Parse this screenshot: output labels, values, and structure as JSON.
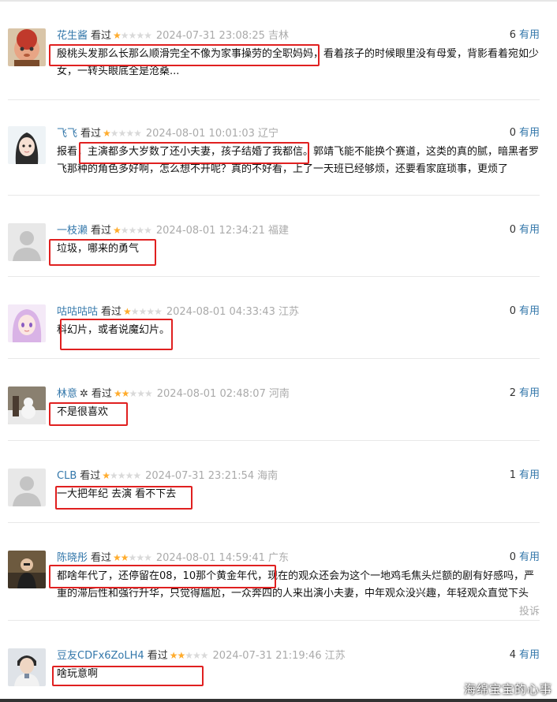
{
  "colors": {
    "link": "#3377aa",
    "star": "#ffac2d",
    "highlight": "#e02020",
    "muted": "#aaaaaa"
  },
  "comments": [
    {
      "user": "花生酱",
      "watched": "看过",
      "rating": 1,
      "time": "2024-07-31 23:08:25",
      "location": "吉林",
      "votes": "6",
      "vote_label": "有用",
      "avatar": "cartoon-avatar",
      "text": "殷桃头发那么长那么顺滑完全不像为家事操劳的全职妈妈，看着孩子的时候眼里没有母爱，背影看着宛如少女，一转头眼底全是沧桑..."
    },
    {
      "user": "飞飞",
      "watched": "看过",
      "rating": 1,
      "time": "2024-08-01 10:01:03",
      "location": "辽宁",
      "votes": "0",
      "vote_label": "有用",
      "avatar": "anime-girl-avatar",
      "text": "报看，主演都多大岁数了还小夫妻，孩子结婚了我都信。郭靖飞能不能换个赛道，这类的真的腻，暗黑者罗飞那种的角色多好啊，怎么想不开呢？真的不好看，上了一天班已经够烦，还要看家庭琐事，更烦了"
    },
    {
      "user": "一枝濑",
      "watched": "看过",
      "rating": 1,
      "time": "2024-08-01 12:34:21",
      "location": "福建",
      "votes": "0",
      "vote_label": "有用",
      "avatar": "default-avatar",
      "text": "垃圾，哪来的勇气"
    },
    {
      "user": "咕咕咕咕",
      "watched": "看过",
      "rating": 1,
      "time": "2024-08-01 04:33:43",
      "location": "江苏",
      "votes": "0",
      "vote_label": "有用",
      "avatar": "anime-pink-avatar",
      "text": "科幻片，或者说魔幻片。"
    },
    {
      "user": "林意",
      "watched": "看过",
      "rating": 2,
      "time": "2024-08-01 02:48:07",
      "location": "河南",
      "votes": "2",
      "vote_label": "有用",
      "avatar": "snowman-photo-avatar",
      "text": "不是很喜欢"
    },
    {
      "user": "CLB",
      "watched": "看过",
      "rating": 1,
      "time": "2024-07-31 23:21:54",
      "location": "海南",
      "votes": "1",
      "vote_label": "有用",
      "avatar": "default-avatar",
      "text": "一大把年纪 去演 看不下去"
    },
    {
      "user": "陈晓彤",
      "watched": "看过",
      "rating": 2,
      "time": "2024-08-01 14:59:41",
      "location": "广东",
      "votes": "0",
      "vote_label": "有用",
      "avatar": "photo-avatar",
      "text": "都啥年代了，还停留在08，10那个黄金年代，现在的观众还会为这个一地鸡毛焦头烂额的剧有好感吗，严重的滞后性和强行升华，只觉得尴尬，一众奔四的人来出演小夫妻，中年观众没兴趣，年轻观众直觉下头",
      "report": "投诉"
    },
    {
      "user": "豆友CDFx6ZoLH4",
      "watched": "看过",
      "rating": 2,
      "time": "2024-07-31 21:19:46",
      "location": "江苏",
      "votes": "4",
      "vote_label": "有用",
      "avatar": "portrait-avatar",
      "text": "啥玩意啊"
    }
  ],
  "watermark": "海绵宝宝的心事"
}
